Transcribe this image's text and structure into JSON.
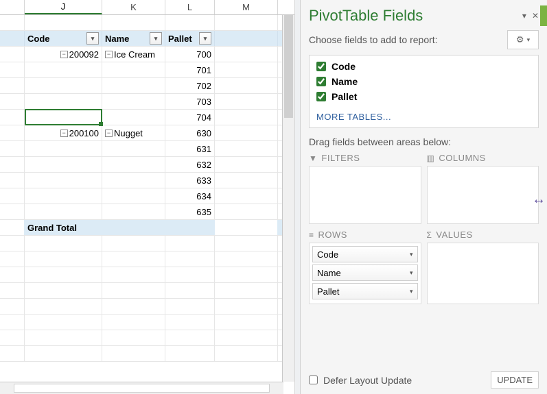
{
  "columns": {
    "J": "J",
    "K": "K",
    "L": "L",
    "M": "M"
  },
  "pivot_headers": {
    "code": "Code",
    "name": "Name",
    "pallet": "Pallet"
  },
  "pivot_rows": [
    {
      "code": "200092",
      "name": "Ice Cream",
      "pallets": [
        "700",
        "701",
        "702",
        "703",
        "704"
      ]
    },
    {
      "code": "200100",
      "name": "Nugget",
      "pallets": [
        "630",
        "631",
        "632",
        "633",
        "634",
        "635"
      ]
    }
  ],
  "grand_total": "Grand Total",
  "panel": {
    "title": "PivotTable Fields",
    "subtitle": "Choose fields to add to report:",
    "fields": [
      {
        "label": "Code",
        "checked": true
      },
      {
        "label": "Name",
        "checked": true
      },
      {
        "label": "Pallet",
        "checked": true
      }
    ],
    "more_tables": "MORE TABLES...",
    "drag_hint": "Drag fields between areas below:",
    "areas": {
      "filters": "FILTERS",
      "columns": "COLUMNS",
      "rows": "ROWS",
      "values": "VALUES"
    },
    "rows_chips": [
      "Code",
      "Name",
      "Pallet"
    ],
    "defer": "Defer Layout Update",
    "update": "UPDATE"
  }
}
